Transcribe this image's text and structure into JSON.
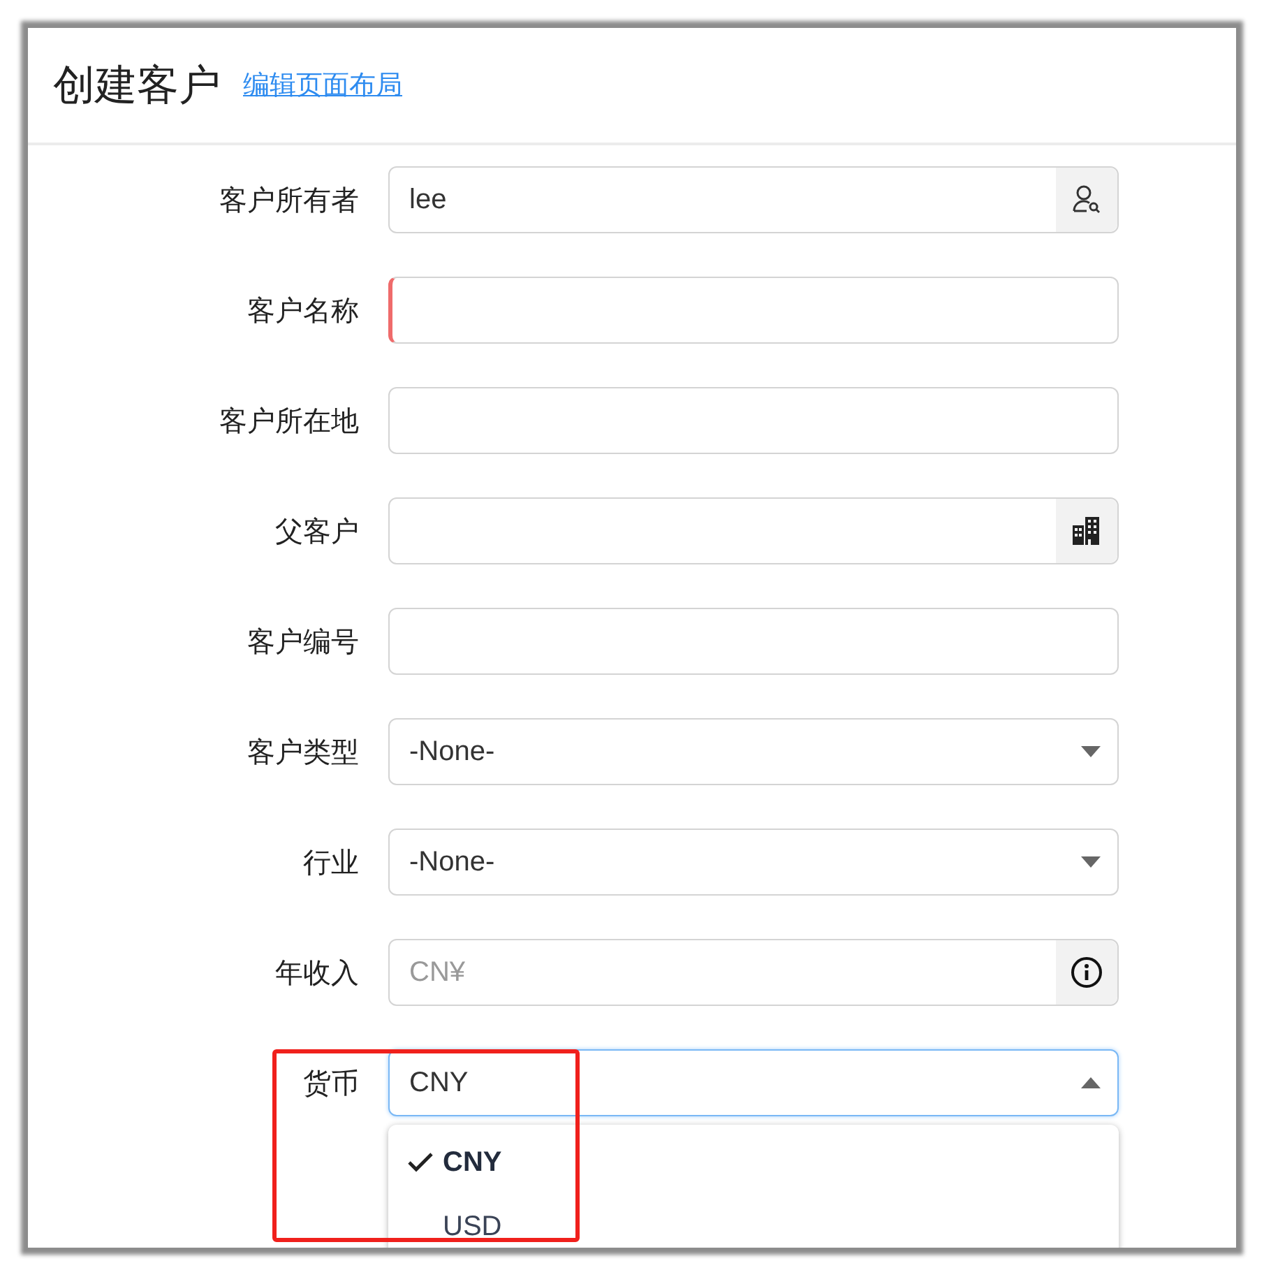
{
  "header": {
    "title": "创建客户",
    "link": "编辑页面布局"
  },
  "fields": [
    {
      "label": "客户所有者",
      "kind": "user-lookup",
      "value": "lee",
      "required": false
    },
    {
      "label": "客户名称",
      "kind": "text",
      "required": true
    },
    {
      "label": "客户所在地",
      "kind": "text",
      "required": false
    },
    {
      "label": "父客户",
      "kind": "account-lookup",
      "required": false
    },
    {
      "label": "客户编号",
      "kind": "text",
      "required": false
    },
    {
      "label": "客户类型",
      "kind": "picklist",
      "value": "-None-",
      "expanded": false,
      "required": false
    },
    {
      "label": "行业",
      "kind": "picklist",
      "value": "-None-",
      "expanded": false,
      "required": false
    },
    {
      "label": "年收入",
      "kind": "currency",
      "placeholder": "CN¥",
      "required": false
    },
    {
      "label": "货币",
      "kind": "picklist",
      "value": "CNY",
      "expanded": true,
      "required": false,
      "highlighted": true,
      "options": [
        {
          "label": "CNY",
          "selected": true
        },
        {
          "label": "USD",
          "selected": false
        }
      ]
    }
  ]
}
